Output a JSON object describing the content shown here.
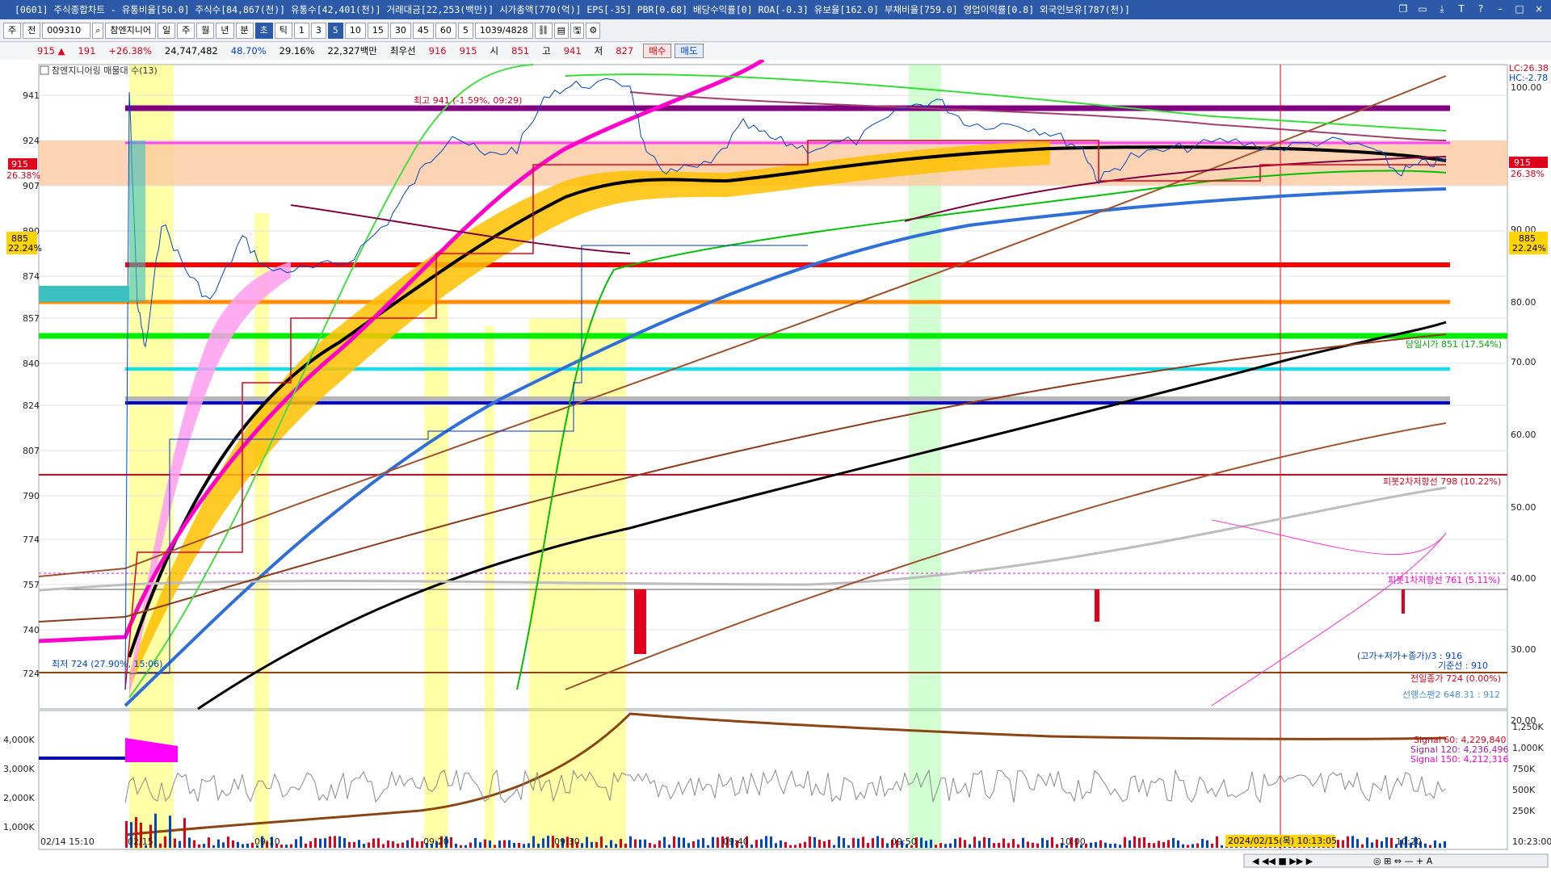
{
  "window": {
    "title": "[0601] 주식종합차트 - 유통비율[50.0] 주식수[84,867(천)] 유통수[42,401(천)] 거래대금[22,253(백만)] 시가총액[770(억)] EPS[-35] PBR[0.68] 배당수익률[0] ROA[-0.3] 유보율[162.0] 부채비율[759.0] 영업이익률[0.8] 외국인보유[787(천)]",
    "controls": [
      "❐",
      "▭",
      "⤓",
      "T",
      "?",
      "–",
      "□",
      "×"
    ]
  },
  "toolbar": {
    "period_label": "주",
    "field_label": "전",
    "code": "009310",
    "name": "참엔지니어",
    "periods": [
      "일",
      "주",
      "월",
      "년",
      "분",
      "초",
      "틱"
    ],
    "selected_period": "초",
    "intervals": [
      "1",
      "3",
      "5",
      "10",
      "15",
      "30",
      "45",
      "60"
    ],
    "selected_interval": "5",
    "interval_select": "5",
    "count": "1039/4828"
  },
  "quote": {
    "price": "915 ▲",
    "change": "191",
    "change_rate": "+26.38%",
    "volume": "24,747,482",
    "ratio1": "48.70%",
    "ratio2": "29.16%",
    "amount": "22,327백만",
    "low_priority": "최우선",
    "best": "916",
    "best2": "915",
    "open_label": "시",
    "open": "851",
    "high_label": "고",
    "high": "941",
    "low_label": "저",
    "low": "827",
    "buy": "매수",
    "sell": "매도"
  },
  "chart": {
    "legend": "참엔지니어링 매물대 수(13)",
    "annotations": {
      "high": "최고 941 (-1.59%, 09:29)",
      "low": "최저 724 (27.90%, 15:06)",
      "open": "당일시가 851 (17.54%)",
      "pivot2": "피봇2차저항선 798 (10.22%)",
      "pivot1": "피봇1차저항선 761 (5.11%)",
      "legend_right1": "(고가+저가+종가)/3 : 916",
      "legend_right2": "기준선 : 910",
      "legend_right3": "전일종가 724 (0.00%)",
      "legend_right4": "선행스팬2 648.31 : 912",
      "lc": "LC:26.38",
      "hc": "HC:-2.78",
      "cur_tag": "915",
      "cur_tag_pct": "26.38%",
      "left_tag": "915",
      "left_tag_pct": "26.38%",
      "mid_tag": "885",
      "mid_tag_pct": "22.24%",
      "right_mid_tag": "885",
      "right_mid_tag_pct": "22.24%"
    },
    "price_ticks": [
      "941",
      "924",
      "907",
      "890",
      "874",
      "857",
      "840",
      "824",
      "807",
      "790",
      "774",
      "757",
      "740",
      "724"
    ],
    "pct_ticks": [
      "100.00",
      "90.00",
      "80.00",
      "70.00",
      "60.00",
      "50.00",
      "40.00",
      "30.00",
      "20.00"
    ],
    "vol_ticks": [
      "4,000K",
      "3,000K",
      "2,000K",
      "1,000K"
    ],
    "vol_ticks_right": [
      "1,250K",
      "1,000K",
      "750K",
      "500K",
      "250K"
    ],
    "time_ticks": [
      "02/14 15:10",
      "02/15",
      "09:10",
      "09:20",
      "09:30",
      "09:40",
      "09:50",
      "10:00",
      "10:20",
      "10:23:00"
    ],
    "cursor_time": "2024/02/15(목) 10:13:05",
    "signals": [
      "Signal 60: 4,229,840",
      "Signal 120: 4,236,496",
      "Signal 150: 4,212,316"
    ],
    "colors": {
      "up": "#e0001b",
      "down": "#0045c8",
      "green": "#00dd00",
      "gold": "#ffbf00"
    }
  }
}
